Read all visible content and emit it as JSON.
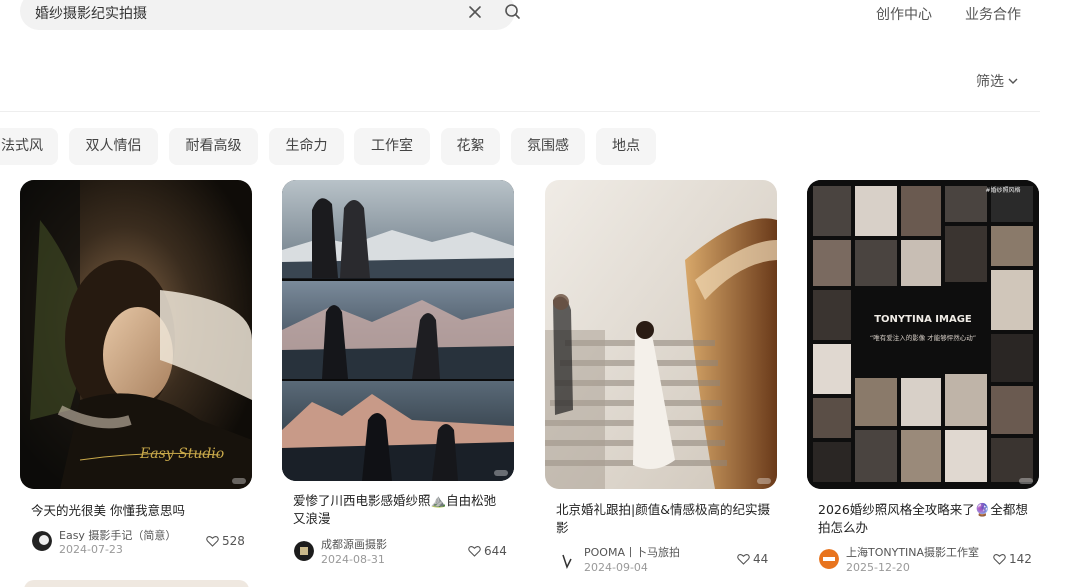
{
  "search": {
    "query": "婚纱摄影纪实拍摄"
  },
  "header": {
    "links": [
      "创作中心",
      "业务合作"
    ]
  },
  "filter": {
    "label": "筛选"
  },
  "tags": [
    "法式风",
    "双人情侣",
    "耐看高级",
    "生命力",
    "工作室",
    "花絮",
    "氛围感",
    "地点"
  ],
  "cards": [
    {
      "title": "今天的光很美 你懂我意思吗",
      "author": "Easy 摄影手记（简意）",
      "date": "2024-07-23",
      "likes": "528"
    },
    {
      "title": "爱惨了川西电影感婚纱照⛰️自由松弛又浪漫",
      "author": "成都源画摄影",
      "date": "2024-08-31",
      "likes": "644"
    },
    {
      "title": "北京婚礼跟拍|颜值&情感极高的纪实摄影",
      "author": "POOMA丨卜马旅拍",
      "date": "2024-09-04",
      "likes": "44"
    },
    {
      "title": "2026婚纱照风格全攻略来了🔮全都想拍怎么办",
      "author": "上海TONYTINA摄影工作室",
      "date": "2025-12-20",
      "likes": "142"
    }
  ],
  "card_images": {
    "card1_signature": "Easy Studio",
    "card4_brand": "TONYTINA IMAGE",
    "card4_tagline": "#婚纱照风格",
    "card4_slogan": "“唯有爱注入的影像 才能够怦然心动”"
  },
  "colors": {
    "background": "#ffffff",
    "tag_bg": "#f5f5f5",
    "search_bg": "#f2f2f2"
  }
}
